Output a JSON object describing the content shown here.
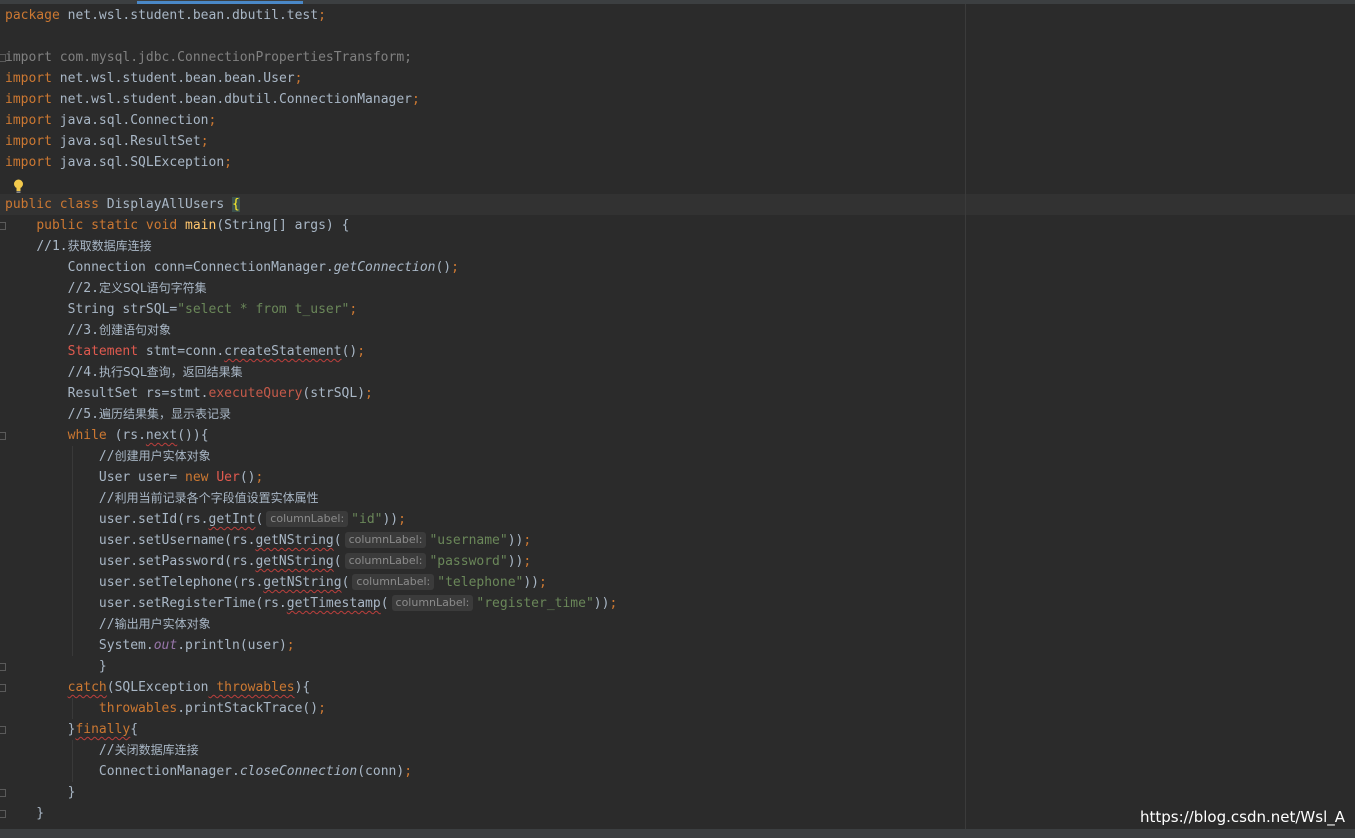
{
  "editor": {
    "watermark": "https://blog.csdn.net/Wsl_A",
    "lines": [
      [
        {
          "t": "package",
          "c": "kw"
        },
        {
          "t": " net.wsl.student.bean.dbutil.test"
        },
        {
          "t": ";",
          "c": "kw"
        }
      ],
      [],
      [
        {
          "t": "import com.mysql.jdbc.ConnectionPropertiesTransform;",
          "c": "gray"
        }
      ],
      [
        {
          "t": "import",
          "c": "kw"
        },
        {
          "t": " net.wsl.student.bean.bean.User"
        },
        {
          "t": ";",
          "c": "kw"
        }
      ],
      [
        {
          "t": "import",
          "c": "kw"
        },
        {
          "t": " net.wsl.student.bean.dbutil.ConnectionManager"
        },
        {
          "t": ";",
          "c": "kw"
        }
      ],
      [
        {
          "t": "import",
          "c": "kw"
        },
        {
          "t": " java.sql.Connection"
        },
        {
          "t": ";",
          "c": "kw"
        }
      ],
      [
        {
          "t": "import",
          "c": "kw"
        },
        {
          "t": " java.sql.ResultSet"
        },
        {
          "t": ";",
          "c": "kw"
        }
      ],
      [
        {
          "t": "import",
          "c": "kw"
        },
        {
          "t": " java.sql.SQLException"
        },
        {
          "t": ";",
          "c": "kw"
        }
      ],
      [],
      [
        {
          "t": "public class",
          "c": "kw"
        },
        {
          "t": " DisplayAllUsers "
        },
        {
          "t": "{",
          "c": "brace-hl"
        }
      ],
      [
        {
          "t": "    "
        },
        {
          "t": "public static void",
          "c": "kw"
        },
        {
          "t": " "
        },
        {
          "t": "main",
          "c": "fn"
        },
        {
          "t": "(String[] args) {"
        }
      ],
      [
        {
          "t": "    "
        },
        {
          "t": "//1.",
          "c": "cm"
        },
        {
          "t": "获取数据库连接",
          "c": "cm cmz"
        }
      ],
      [
        {
          "t": "        Connection conn=ConnectionManager."
        },
        {
          "t": "getConnection",
          "c": "static-it"
        },
        {
          "t": "()"
        },
        {
          "t": ";",
          "c": "kw"
        }
      ],
      [
        {
          "t": "        "
        },
        {
          "t": "//2.",
          "c": "cm"
        },
        {
          "t": "定义SQL语句字符集",
          "c": "cm cmz"
        }
      ],
      [
        {
          "t": "        String strSQL="
        },
        {
          "t": "\"select * from t_user\"",
          "c": "str"
        },
        {
          "t": ";",
          "c": "kw"
        }
      ],
      [
        {
          "t": "        "
        },
        {
          "t": "//3.",
          "c": "cm"
        },
        {
          "t": "创建语句对象",
          "c": "cm cmz"
        }
      ],
      [
        {
          "t": "        "
        },
        {
          "t": "Statement",
          "c": "err"
        },
        {
          "t": " stmt=conn."
        },
        {
          "t": "createStatement",
          "c": "squig"
        },
        {
          "t": "()"
        },
        {
          "t": ";",
          "c": "kw"
        }
      ],
      [
        {
          "t": "        "
        },
        {
          "t": "//4.",
          "c": "cm"
        },
        {
          "t": "执行SQL查询，返回结果集",
          "c": "cm cmz"
        }
      ],
      [
        {
          "t": "        ResultSet rs=stmt."
        },
        {
          "t": "executeQuery",
          "c": "mth"
        },
        {
          "t": "(strSQL)"
        },
        {
          "t": ";",
          "c": "kw"
        }
      ],
      [
        {
          "t": "        "
        },
        {
          "t": "//5.",
          "c": "cm"
        },
        {
          "t": "遍历结果集，显示表记录",
          "c": "cm cmz"
        }
      ],
      [
        {
          "t": "        "
        },
        {
          "t": "while",
          "c": "kw"
        },
        {
          "t": " (rs."
        },
        {
          "t": "next",
          "c": "squig"
        },
        {
          "t": "()){"
        }
      ],
      [
        {
          "t": "            "
        },
        {
          "t": "//",
          "c": "cm"
        },
        {
          "t": "创建用户实体对象",
          "c": "cm cmz"
        }
      ],
      [
        {
          "t": "            User user= "
        },
        {
          "t": "new",
          "c": "kw"
        },
        {
          "t": " "
        },
        {
          "t": "Uer",
          "c": "err"
        },
        {
          "t": "()"
        },
        {
          "t": ";",
          "c": "kw"
        }
      ],
      [
        {
          "t": "            "
        },
        {
          "t": "//",
          "c": "cm"
        },
        {
          "t": "利用当前记录各个字段值设置实体属性",
          "c": "cm cmz"
        }
      ],
      [
        {
          "t": "            user.setId(rs."
        },
        {
          "t": "getInt",
          "c": "squig"
        },
        {
          "t": "("
        },
        {
          "h": "columnLabel:"
        },
        {
          "t": "\"id\"",
          "c": "str"
        },
        {
          "t": "))"
        },
        {
          "t": ";",
          "c": "kw"
        }
      ],
      [
        {
          "t": "            user.setUsername(rs."
        },
        {
          "t": "getNString",
          "c": "squig"
        },
        {
          "t": "("
        },
        {
          "h": "columnLabel:"
        },
        {
          "t": "\"username\"",
          "c": "str"
        },
        {
          "t": "))"
        },
        {
          "t": ";",
          "c": "kw"
        }
      ],
      [
        {
          "t": "            user.setPassword(rs."
        },
        {
          "t": "getNString",
          "c": "squig"
        },
        {
          "t": "("
        },
        {
          "h": "columnLabel:"
        },
        {
          "t": "\"password\"",
          "c": "str"
        },
        {
          "t": "))"
        },
        {
          "t": ";",
          "c": "kw"
        }
      ],
      [
        {
          "t": "            user.setTelephone(rs."
        },
        {
          "t": "getNString",
          "c": "squig"
        },
        {
          "t": "("
        },
        {
          "h": "columnLabel:"
        },
        {
          "t": "\"telephone\"",
          "c": "str"
        },
        {
          "t": "))"
        },
        {
          "t": ";",
          "c": "kw"
        }
      ],
      [
        {
          "t": "            user.setRegisterTime(rs."
        },
        {
          "t": "getTimestamp",
          "c": "squig"
        },
        {
          "t": "("
        },
        {
          "h": "columnLabel:"
        },
        {
          "t": "\"register_time\"",
          "c": "str"
        },
        {
          "t": "))"
        },
        {
          "t": ";",
          "c": "kw"
        }
      ],
      [
        {
          "t": "            "
        },
        {
          "t": "//",
          "c": "cm"
        },
        {
          "t": "输出用户实体对象",
          "c": "cm cmz"
        }
      ],
      [
        {
          "t": "            System."
        },
        {
          "t": "out",
          "c": "static-f"
        },
        {
          "t": ".println(user)"
        },
        {
          "t": ";",
          "c": "kw"
        }
      ],
      [
        {
          "t": "            }"
        }
      ],
      [
        {
          "t": "        "
        },
        {
          "t": "catch",
          "c": "squig kw"
        },
        {
          "t": "(SQLException"
        },
        {
          "t": " throwables",
          "c": "param squig"
        },
        {
          "t": "){"
        }
      ],
      [
        {
          "t": "            "
        },
        {
          "t": "throwables",
          "c": "param"
        },
        {
          "t": ".printStackTrace()"
        },
        {
          "t": ";",
          "c": "kw"
        }
      ],
      [
        {
          "t": "        }"
        },
        {
          "t": "finally",
          "c": "kw squig"
        },
        {
          "t": "{"
        }
      ],
      [
        {
          "t": "            "
        },
        {
          "t": "//",
          "c": "cm"
        },
        {
          "t": "关闭数据库连接",
          "c": "cm cmz"
        }
      ],
      [
        {
          "t": "            ConnectionManager."
        },
        {
          "t": "closeConnection",
          "c": "static-it"
        },
        {
          "t": "(conn)"
        },
        {
          "t": ";",
          "c": "kw"
        }
      ],
      [
        {
          "t": "        }"
        }
      ],
      [
        {
          "t": "    }"
        }
      ]
    ]
  }
}
